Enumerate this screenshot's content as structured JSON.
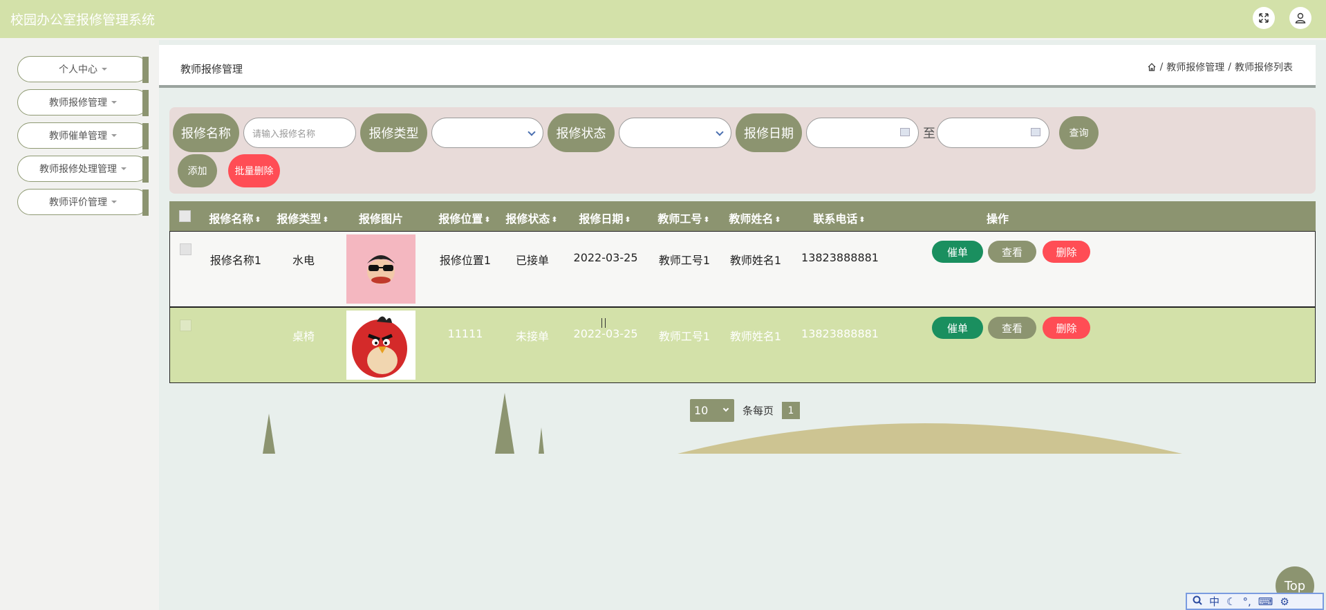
{
  "app": {
    "title": "校园办公室报修管理系统"
  },
  "colors": {
    "topbar": "#d3e1a9",
    "accent": "#8c9470",
    "danger": "#ff4d55",
    "success": "#1a8f5f"
  },
  "sidebar": {
    "items": [
      {
        "label": "个人中心"
      },
      {
        "label": "教师报修管理"
      },
      {
        "label": "教师催单管理"
      },
      {
        "label": "教师报修处理管理"
      },
      {
        "label": "教师评价管理"
      }
    ]
  },
  "header": {
    "title": "教师报修管理",
    "breadcrumb": [
      "教师报修管理",
      "教师报修列表"
    ],
    "separator": "/"
  },
  "search": {
    "name_label": "报修名称",
    "name_placeholder": "请输入报修名称",
    "type_label": "报修类型",
    "status_label": "报修状态",
    "date_label": "报修日期",
    "to_label": "至",
    "query_button": "查询",
    "add_button": "添加",
    "batch_delete_button": "批量删除"
  },
  "table": {
    "headers": [
      "报修名称",
      "报修类型",
      "报修图片",
      "报修位置",
      "报修状态",
      "报修日期",
      "教师工号",
      "教师姓名",
      "联系电话",
      "操作"
    ],
    "rows": [
      {
        "name": "报修名称1",
        "type": "水电",
        "location": "报修位置1",
        "status": "已接单",
        "date": "2022-03-25",
        "teacher_id": "教师工号1",
        "teacher_name": "教师姓名1",
        "phone": "13823888881",
        "image": "monkey-avatar-image"
      },
      {
        "name": "",
        "type": "桌椅",
        "location": "11111",
        "status": "未接单",
        "date": "2022-03-25",
        "teacher_id": "教师工号1",
        "teacher_name": "教师姓名1",
        "phone": "13823888881",
        "image": "red-bird-image"
      }
    ],
    "actions": {
      "urge": "催单",
      "view": "查看",
      "delete": "删除"
    }
  },
  "pager": {
    "page_size": "10",
    "per_page_label": "条每页",
    "current_page": "1"
  },
  "back_to_top": "Top",
  "ime": {
    "mode": "中"
  }
}
